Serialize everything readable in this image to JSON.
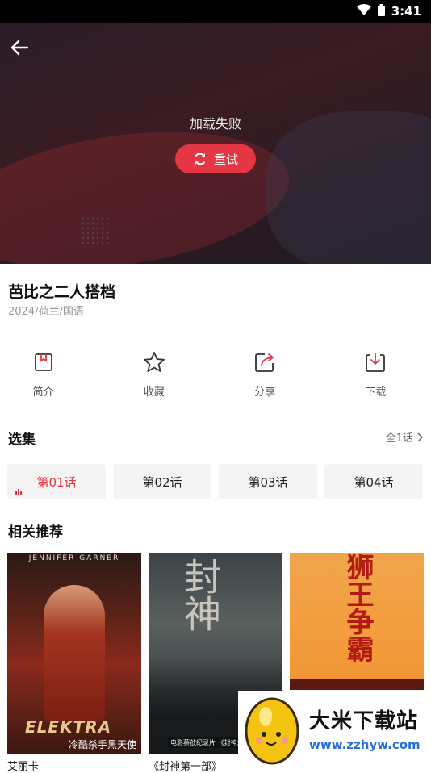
{
  "status_bar": {
    "time": "3:41"
  },
  "player": {
    "error_message": "加载失败",
    "retry_label": "重试"
  },
  "show": {
    "title": "芭比之二人搭档",
    "meta": "2024/荷兰/国语"
  },
  "actions": [
    {
      "label": "简介",
      "icon": "bookmark-icon"
    },
    {
      "label": "收藏",
      "icon": "star-icon"
    },
    {
      "label": "分享",
      "icon": "share-icon"
    },
    {
      "label": "下载",
      "icon": "download-icon"
    }
  ],
  "episodes_section": {
    "title": "选集",
    "all_label": "全1话",
    "items": [
      {
        "label": "第01话",
        "active": true
      },
      {
        "label": "第02话",
        "active": false
      },
      {
        "label": "第03话",
        "active": false
      },
      {
        "label": "第04话",
        "active": false
      }
    ]
  },
  "recommend_section": {
    "title": "相关推荐",
    "items": [
      {
        "title": "艾丽卡",
        "poster_top": "JENNIFER GARNER",
        "poster_logo": "ELEKTRA",
        "poster_caption": "冷酷杀手黑天使"
      },
      {
        "title": "《封神第一部》",
        "poster_big": "封神",
        "poster_caption": "电影蔡啟纪录片 《封神之路》第一"
      },
      {
        "title": "",
        "poster_big": "狮王争霸"
      }
    ]
  },
  "watermark": {
    "title": "大米下载站",
    "url": "www.zzhyw.com"
  },
  "colors": {
    "accent": "#e53643"
  }
}
